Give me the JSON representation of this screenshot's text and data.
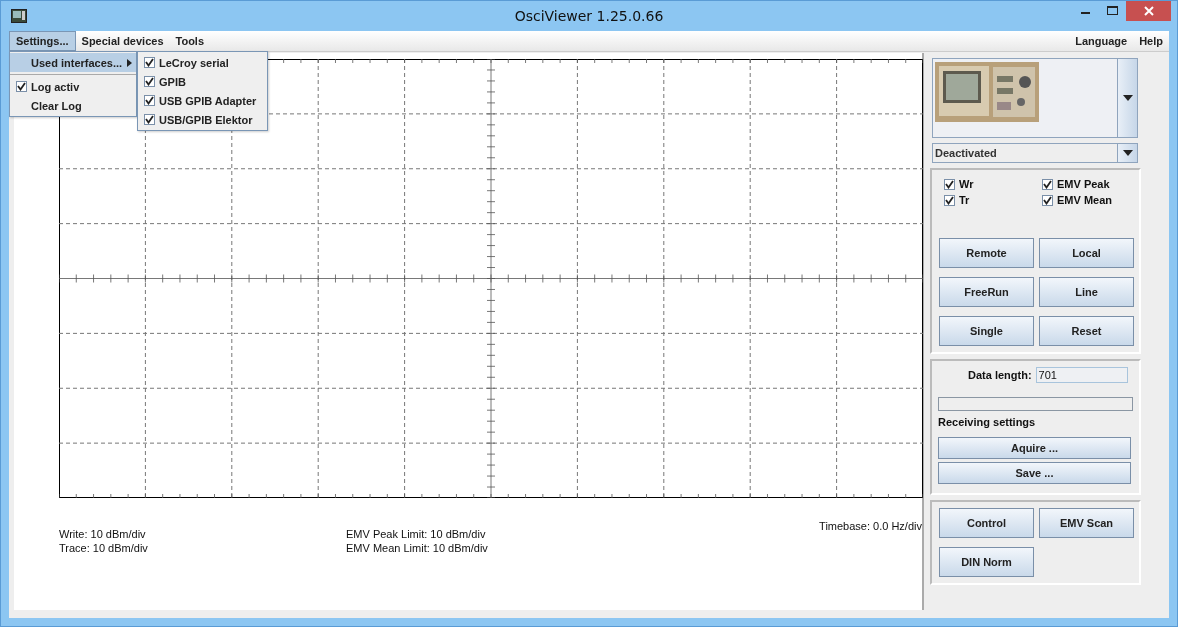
{
  "window": {
    "title": "OsciViewer 1.25.0.66"
  },
  "menu_bar": {
    "left": [
      {
        "label": "Settings...",
        "selected": true
      },
      {
        "label": "Special devices",
        "selected": false
      },
      {
        "label": "Tools",
        "selected": false
      }
    ],
    "right": [
      {
        "label": "Language",
        "selected": false
      },
      {
        "label": "Help",
        "selected": false
      }
    ]
  },
  "settings_menu": {
    "items": [
      {
        "kind": "submenu",
        "label": "Used interfaces...",
        "selected": true
      },
      {
        "kind": "separator"
      },
      {
        "kind": "check",
        "label": "Log activ",
        "checked": true,
        "selected": false
      },
      {
        "kind": "check",
        "label": "Clear Log",
        "checked": false,
        "selected": false
      }
    ]
  },
  "interfaces_submenu": {
    "items": [
      {
        "label": "LeCroy serial",
        "checked": true
      },
      {
        "label": "GPIB",
        "checked": true
      },
      {
        "label": "USB GPIB Adapter",
        "checked": true
      },
      {
        "label": "USB/GPIB Elektor",
        "checked": true
      }
    ]
  },
  "readouts": [
    {
      "lines": [
        "Write:  10 dBm/div",
        "Trace:  10 dBm/div"
      ]
    },
    {
      "lines": [
        "EMV Peak Limit:  10 dBm/div",
        "EMV Mean Limit:  10 dBm/div"
      ]
    }
  ],
  "timebase": "Timebase: 0.0 Hz/div",
  "device_selector": {
    "kind": "picture"
  },
  "mode_select": {
    "value": "Deactivated"
  },
  "traces": [
    {
      "label": "Wr",
      "checked": true
    },
    {
      "label": "EMV Peak",
      "checked": true
    },
    {
      "label": "Tr",
      "checked": true
    },
    {
      "label": "EMV Mean",
      "checked": true
    }
  ],
  "control_buttons": [
    "Remote",
    "Local",
    "FreeRun",
    "Line",
    "Single",
    "Reset"
  ],
  "data_length": {
    "label": "Data length:",
    "value": "701"
  },
  "progress": {
    "level": 0
  },
  "receiving_label": "Receiving settings",
  "receiving_buttons": [
    "Aquire ...",
    "Save ..."
  ],
  "bottom_buttons": [
    "Control",
    "EMV Scan",
    "DIN Norm"
  ]
}
